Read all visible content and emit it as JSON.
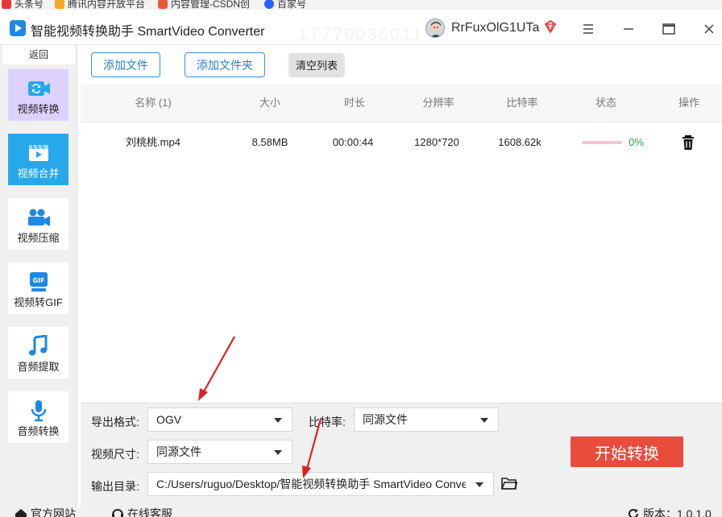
{
  "bookmarks": [
    {
      "label": "头条号",
      "color": "#e53935"
    },
    {
      "label": "腾讯内容开放平台",
      "color": "#f5a623"
    },
    {
      "label": "内容管理-CSDN创",
      "color": "#e8573b"
    },
    {
      "label": "百家号",
      "color": "#2962ff"
    }
  ],
  "app": {
    "title": "智能视频转换助手 SmartVideo Converter",
    "watermark": "17770036011",
    "username": "RrFuxOlG1UTa",
    "logo_icon": "play-icon",
    "vip_icon": "diamond-icon"
  },
  "window_controls": [
    "menu-icon",
    "minimize-icon",
    "maximize-icon",
    "close-icon"
  ],
  "sidebar": {
    "back_label": "返回",
    "items": [
      {
        "label": "视频转换",
        "icon": "video-convert-icon",
        "selected": "purple"
      },
      {
        "label": "视频合并",
        "icon": "video-merge-icon",
        "selected": "blue"
      },
      {
        "label": "视频压缩",
        "icon": "video-compress-icon"
      },
      {
        "label": "视频转GIF",
        "icon": "gif-icon"
      },
      {
        "label": "音频提取",
        "icon": "music-note-icon"
      },
      {
        "label": "音频转换",
        "icon": "microphone-icon"
      }
    ]
  },
  "toolbar": {
    "add_file": "添加文件",
    "add_folder": "添加文件夹",
    "clear_list": "清空列表"
  },
  "table": {
    "headers": {
      "name": "名称 (1)",
      "size": "大小",
      "duration": "时长",
      "resolution": "分辨率",
      "bitrate": "比特率",
      "status": "状态",
      "action": "操作"
    },
    "rows": [
      {
        "name": "刘桃桃.mp4",
        "size": "8.58MB",
        "duration": "00:00:44",
        "resolution": "1280*720",
        "bitrate": "1608.62k",
        "progress_label": "0%",
        "progress": 0,
        "action_icon": "trash-icon"
      }
    ]
  },
  "settings": {
    "format_label": "导出格式:",
    "format_value": "OGV",
    "bitrate_label": "比特率:",
    "bitrate_value": "同源文件",
    "size_label": "视频尺寸:",
    "size_value": "同源文件",
    "output_label": "输出目录:",
    "output_value": "C:/Users/ruguo/Desktop/智能视频转换助手 SmartVideo Converter",
    "start_button": "开始转换",
    "folder_icon": "folder-icon"
  },
  "footer": {
    "website": "官方网站",
    "support": "在线客服",
    "version": "版本：1.0.1.0"
  },
  "colors": {
    "accent_blue": "#27a8ea",
    "selected_purple": "#ddd2ff",
    "start_red": "#e94b3c",
    "progress_pink": "#f5c6d1",
    "percent_green": "#2fa043",
    "annotation_red": "#e02020"
  }
}
